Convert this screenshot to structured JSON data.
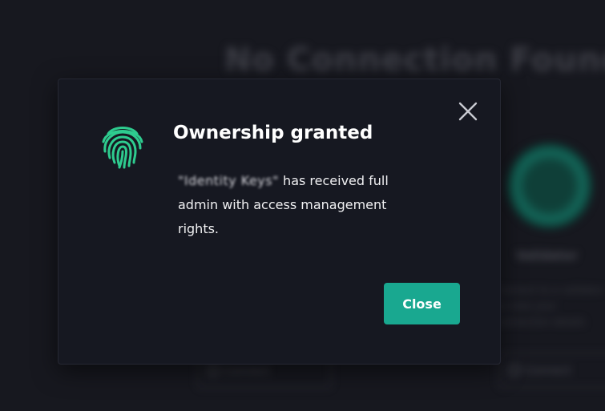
{
  "background": {
    "title": "No Connection Found",
    "card_label": "Validator",
    "card_description": "Connect to a validator to view your connection details",
    "left_button_label": "Connect",
    "right_button_label": "Connect"
  },
  "dialog": {
    "title": "Ownership granted",
    "redacted_name": "\"Identity Keys\"",
    "message_suffix": " has received full admin with access management rights.",
    "close_button_label": "Close",
    "close_icon": "close-icon",
    "fingerprint_icon": "fingerprint-icon"
  },
  "colors": {
    "accent": "#19a890",
    "fingerprint": "#2ecc8f",
    "modal_background": "#161821",
    "page_background": "#17181f"
  }
}
